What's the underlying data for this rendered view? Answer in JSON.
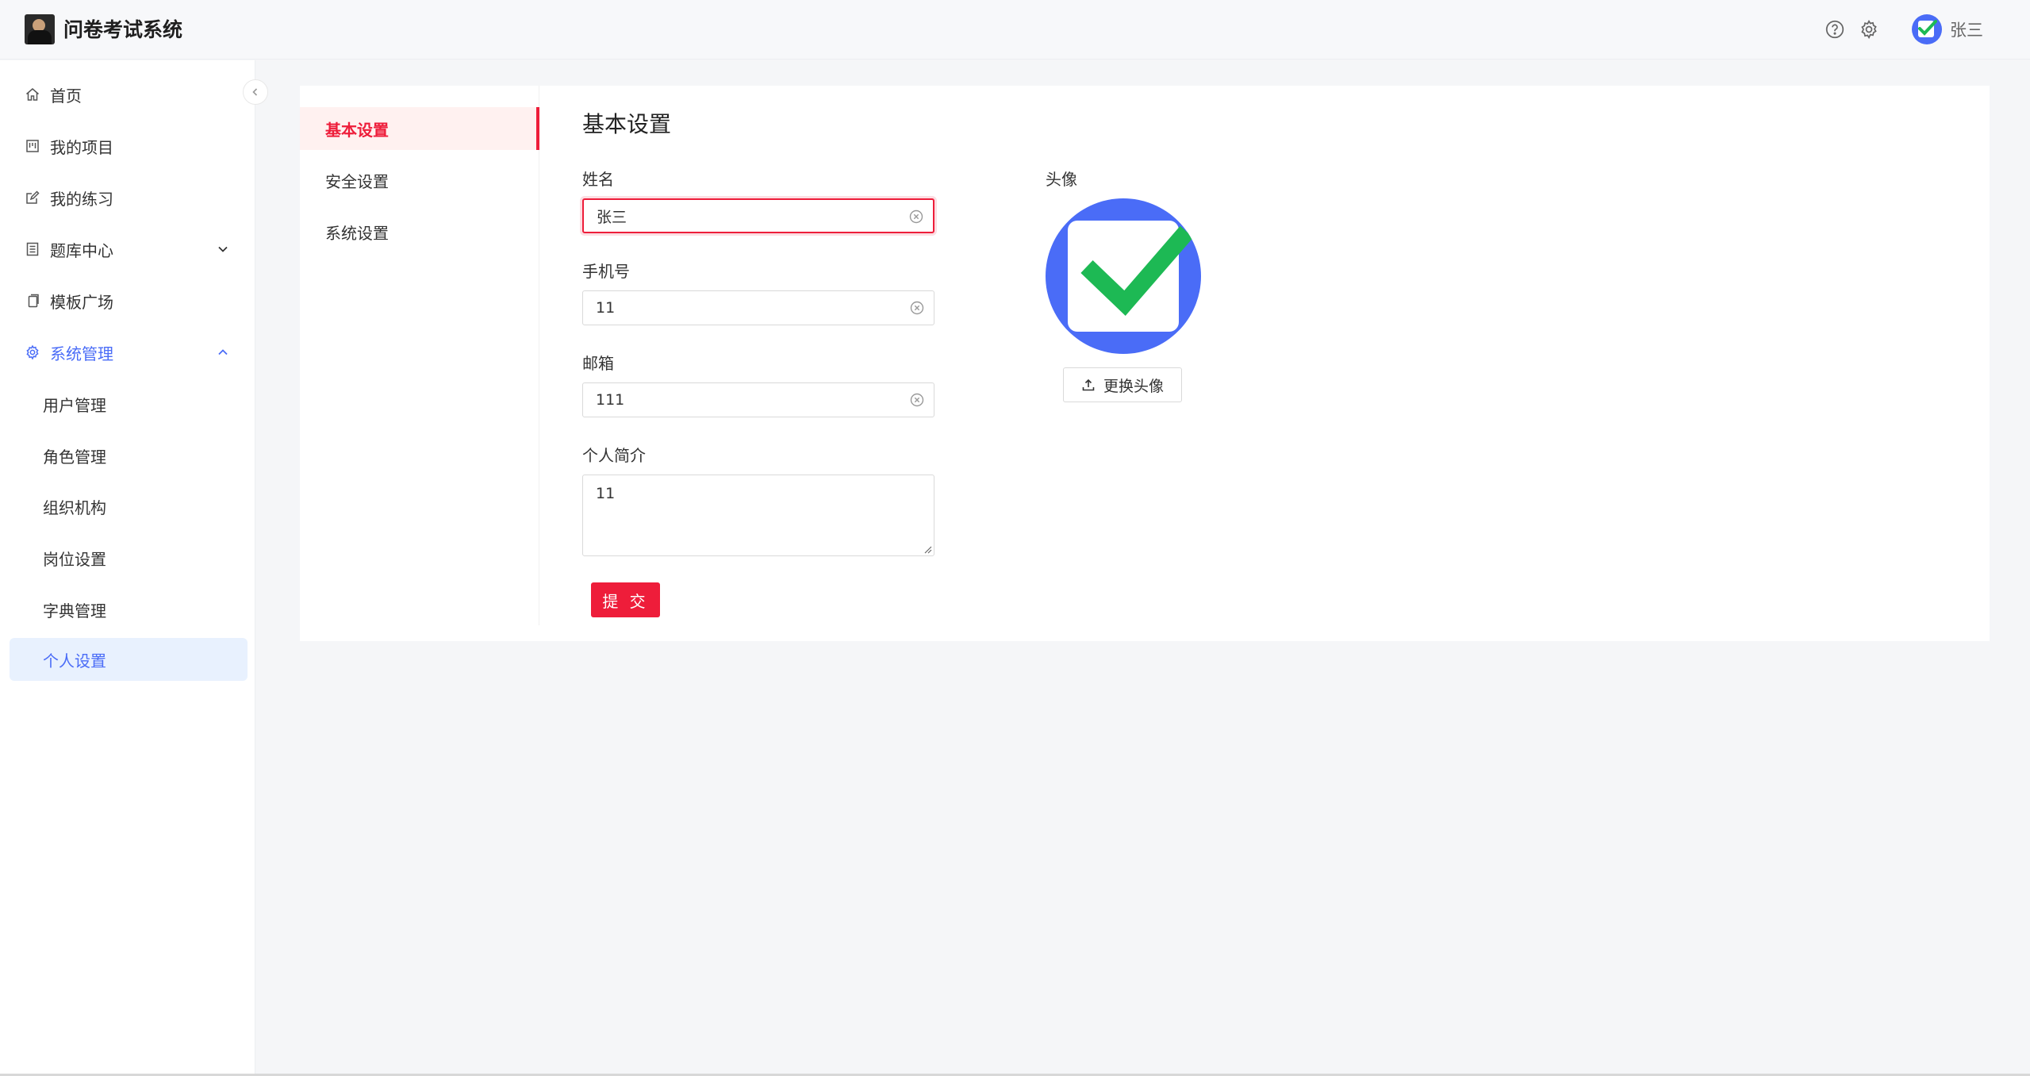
{
  "app": {
    "title": "问卷考试系统",
    "user_name": "张三"
  },
  "header": {
    "help_icon": "question-circle-icon",
    "settings_icon": "gear-icon"
  },
  "sidebar": {
    "items": [
      {
        "label": "首页",
        "icon": "home-icon"
      },
      {
        "label": "我的项目",
        "icon": "project-icon"
      },
      {
        "label": "我的练习",
        "icon": "edit-icon"
      },
      {
        "label": "题库中心",
        "icon": "list-icon"
      },
      {
        "label": "模板广场",
        "icon": "copy-icon"
      },
      {
        "label": "系统管理",
        "icon": "gear-icon"
      }
    ],
    "sub_items": [
      "用户管理",
      "角色管理",
      "组织机构",
      "岗位设置",
      "字典管理",
      "个人设置"
    ],
    "selected": "个人设置"
  },
  "settings_menu": {
    "items": [
      "基本设置",
      "安全设置",
      "系统设置"
    ],
    "active": "基本设置"
  },
  "form": {
    "section_title": "基本设置",
    "name_label": "姓名",
    "name_value": "张三",
    "phone_label": "手机号",
    "phone_value": "11",
    "email_label": "邮箱",
    "email_value": "111",
    "bio_label": "个人简介",
    "bio_value": "11",
    "submit_label": "提 交"
  },
  "avatar": {
    "label": "头像",
    "change_label": "更换头像"
  },
  "colors": {
    "accent_red": "#ee1d3a",
    "accent_blue": "#4a6cf7",
    "check_green": "#1db954"
  }
}
